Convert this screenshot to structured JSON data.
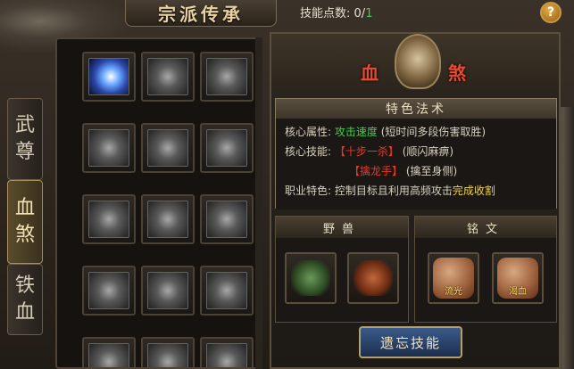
{
  "header": {
    "title": "宗派传承",
    "skill_points_label": "技能点数:",
    "skill_points_used": "0/",
    "skill_points_max": "1",
    "help_label": "?"
  },
  "tabs": [
    {
      "label_1": "武",
      "label_2": "尊",
      "active": false
    },
    {
      "label_1": "血",
      "label_2": "煞",
      "active": true
    },
    {
      "label_1": "铁",
      "label_2": "血",
      "active": false
    }
  ],
  "skills": [
    {
      "icon": "lightning-slash-icon",
      "learned": true
    },
    {
      "icon": "axe-head-icon",
      "learned": false
    },
    {
      "icon": "chain-icon",
      "learned": false
    },
    {
      "icon": "sword-pierce-icon",
      "learned": false
    },
    {
      "icon": "claw-strike-icon",
      "learned": false
    },
    {
      "icon": "cross-blades-icon",
      "learned": false
    },
    {
      "icon": "rune-pillar-icon",
      "learned": false
    },
    {
      "icon": "vortex-icon",
      "learned": false
    },
    {
      "icon": "shield-swirl-icon",
      "learned": false
    },
    {
      "icon": "x-slash-icon",
      "learned": false
    },
    {
      "icon": "burst-icon",
      "learned": false
    },
    {
      "icon": "beast-claw-icon",
      "learned": false
    },
    {
      "icon": "armor-icon",
      "learned": false
    },
    {
      "icon": "figure-icon",
      "learned": false
    },
    {
      "icon": "helmet-icon",
      "learned": false
    }
  ],
  "sect": {
    "name_1": "血",
    "name_2": "煞",
    "emblem": "winged-emblem-icon"
  },
  "feature": {
    "heading": "特色法术",
    "core_attr_label": "核心属性:",
    "core_attr_value": "攻击速度",
    "core_attr_note": "(短时间多段伤害取胜)",
    "core_skill_label": "核心技能:",
    "skill_1": "【十步一杀】",
    "skill_1_note": "(顺闪麻痹)",
    "skill_2": "【擒龙手】",
    "skill_2_note": "(擒至身侧)",
    "job_label": "职业特色:",
    "job_text": "控制目标且利用高频攻击",
    "job_highlight": "完成收割"
  },
  "beast": {
    "heading": "野兽",
    "slots": [
      {
        "icon": "green-dragon-icon"
      },
      {
        "icon": "fire-beast-icon"
      }
    ]
  },
  "rune": {
    "heading": "铭文",
    "slots": [
      {
        "icon": "rune-stone-icon",
        "label": "流光"
      },
      {
        "icon": "rune-stone-icon",
        "label": "渴血"
      }
    ]
  },
  "footer": {
    "forget_button": "遗忘技能"
  },
  "colors": {
    "accent_green": "#3ad24a",
    "accent_red": "#e63a2a",
    "accent_yellow": "#f0d24a",
    "name_red": "#e84a32"
  }
}
